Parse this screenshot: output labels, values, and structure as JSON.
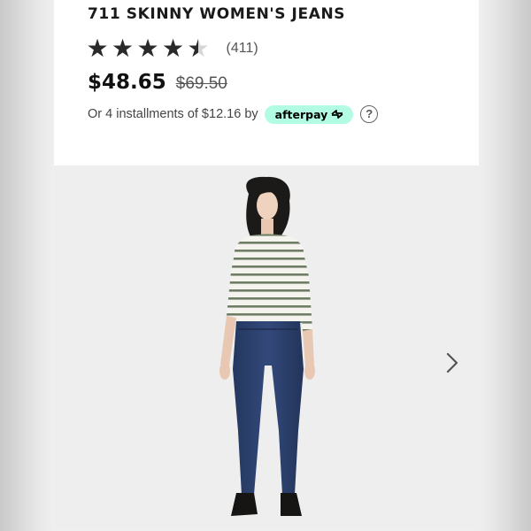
{
  "product": {
    "title": "711 SKINNY WOMEN'S JEANS",
    "rating": 4.5,
    "rating_max": 5,
    "review_count": "(411)",
    "sale_price": "$48.65",
    "original_price": "$69.50",
    "installments_text": "Or 4 installments of $12.16 by",
    "afterpay_label": "afterpay",
    "help_icon": "?"
  },
  "gallery": {
    "next_icon": "chevron-right-icon",
    "image_subject": "model-photo"
  },
  "colors": {
    "afterpay_mint": "#b2fce4",
    "star_filled": "#2a2a2a",
    "star_empty": "#d6d6d6",
    "jeans_denim": "#2a3f6e"
  }
}
